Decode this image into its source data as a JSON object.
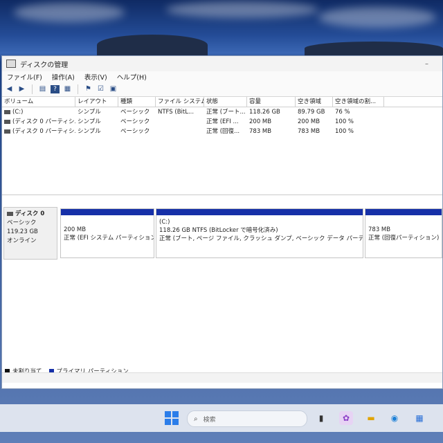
{
  "window": {
    "title": "ディスクの管理",
    "menu": [
      "ファイル(F)",
      "操作(A)",
      "表示(V)",
      "ヘルプ(H)"
    ]
  },
  "volume_table": {
    "headers": [
      "ボリューム",
      "レイアウト",
      "種類",
      "ファイル システム",
      "状態",
      "容量",
      "空き領域",
      "空き領域の割..."
    ],
    "rows": [
      [
        "(C:)",
        "シンプル",
        "ベーシック",
        "NTFS (BitL...",
        "正常 (ブート...",
        "118.26 GB",
        "89.79 GB",
        "76 %"
      ],
      [
        "(ディスク 0 パーティシ...",
        "シンプル",
        "ベーシック",
        "",
        "正常 (EFI ...",
        "200 MB",
        "200 MB",
        "100 %"
      ],
      [
        "(ディスク 0 パーティシ...",
        "シンプル",
        "ベーシック",
        "",
        "正常 (回復...",
        "783 MB",
        "783 MB",
        "100 %"
      ]
    ]
  },
  "disk0": {
    "name": "ディスク 0",
    "type": "ベーシック",
    "size": "119.23 GB",
    "status": "オンライン",
    "partitions": [
      {
        "title": "",
        "size": "200 MB",
        "status": "正常 (EFI システム パーティション)"
      },
      {
        "title": "(C:)",
        "size": "118.26 GB NTFS (BitLocker で暗号化済み)",
        "status": "正常 (ブート, ページ ファイル, クラッシュ ダンプ, ベーシック データ パーティション)"
      },
      {
        "title": "",
        "size": "783 MB",
        "status": "正常 (回復パーティション)"
      }
    ]
  },
  "legend": {
    "unallocated": "未割り当て",
    "primary": "プライマリ パーティション"
  },
  "taskbar": {
    "search_placeholder": "検索"
  },
  "colors": {
    "primary_partition": "#1630a8",
    "unallocated": "#111111"
  }
}
